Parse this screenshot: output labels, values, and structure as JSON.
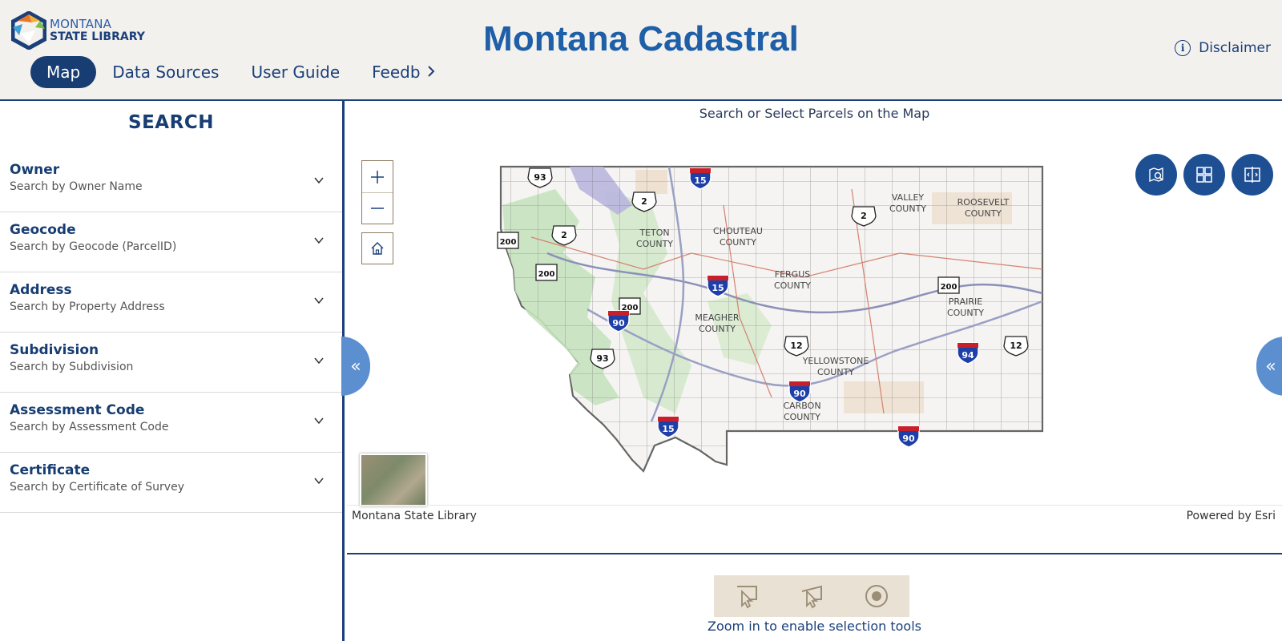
{
  "header": {
    "logo_line1": "MONTANA",
    "logo_line2": "STATE LIBRARY",
    "title": "Montana Cadastral",
    "disclaimer": "Disclaimer",
    "nav": [
      {
        "label": "Map",
        "active": true
      },
      {
        "label": "Data Sources"
      },
      {
        "label": "User Guide"
      },
      {
        "label": "Feedb"
      }
    ]
  },
  "search": {
    "title": "SEARCH",
    "items": [
      {
        "title": "Owner",
        "subtitle": "Search by Owner Name"
      },
      {
        "title": "Geocode",
        "subtitle": "Search by Geocode (ParcelID)"
      },
      {
        "title": "Address",
        "subtitle": "Search by Property Address"
      },
      {
        "title": "Subdivision",
        "subtitle": "Search by Subdivision"
      },
      {
        "title": "Assessment Code",
        "subtitle": "Search by Assessment Code"
      },
      {
        "title": "Certificate",
        "subtitle": "Search by Certificate of Survey"
      }
    ]
  },
  "map": {
    "caption": "Search or Select Parcels on the Map",
    "attribution_left": "Montana State Library",
    "attribution_right": "Powered by Esri",
    "county_labels": [
      {
        "name": "TETON COUNTY",
        "l1": "TETON",
        "l2": "COUNTY"
      },
      {
        "name": "CHOUTEAU COUNTY",
        "l1": "CHOUTEAU",
        "l2": "COUNTY"
      },
      {
        "name": "VALLEY COUNTY",
        "l1": "VALLEY",
        "l2": "COUNTY"
      },
      {
        "name": "ROOSEVELT COUNTY",
        "l1": "ROOSEVELT",
        "l2": "COUNTY"
      },
      {
        "name": "FERGUS COUNTY",
        "l1": "FERGUS",
        "l2": "COUNTY"
      },
      {
        "name": "MEAGHER COUNTY",
        "l1": "MEAGHER",
        "l2": "COUNTY"
      },
      {
        "name": "PRAIRIE COUNTY",
        "l1": "PRAIRIE",
        "l2": "COUNTY"
      },
      {
        "name": "YELLOWSTONE COUNTY",
        "l1": "YELLOWSTONE",
        "l2": "COUNTY"
      },
      {
        "name": "CARBON COUNTY",
        "l1": "CARBON",
        "l2": "COUNTY"
      }
    ],
    "route_shields": [
      "93",
      "2",
      "2",
      "2",
      "200",
      "200",
      "200",
      "200",
      "15",
      "15",
      "15",
      "90",
      "90",
      "90",
      "94",
      "93",
      "12",
      "12"
    ],
    "accent": "#1e4f93"
  },
  "selection": {
    "message": "Zoom in to enable selection tools"
  }
}
